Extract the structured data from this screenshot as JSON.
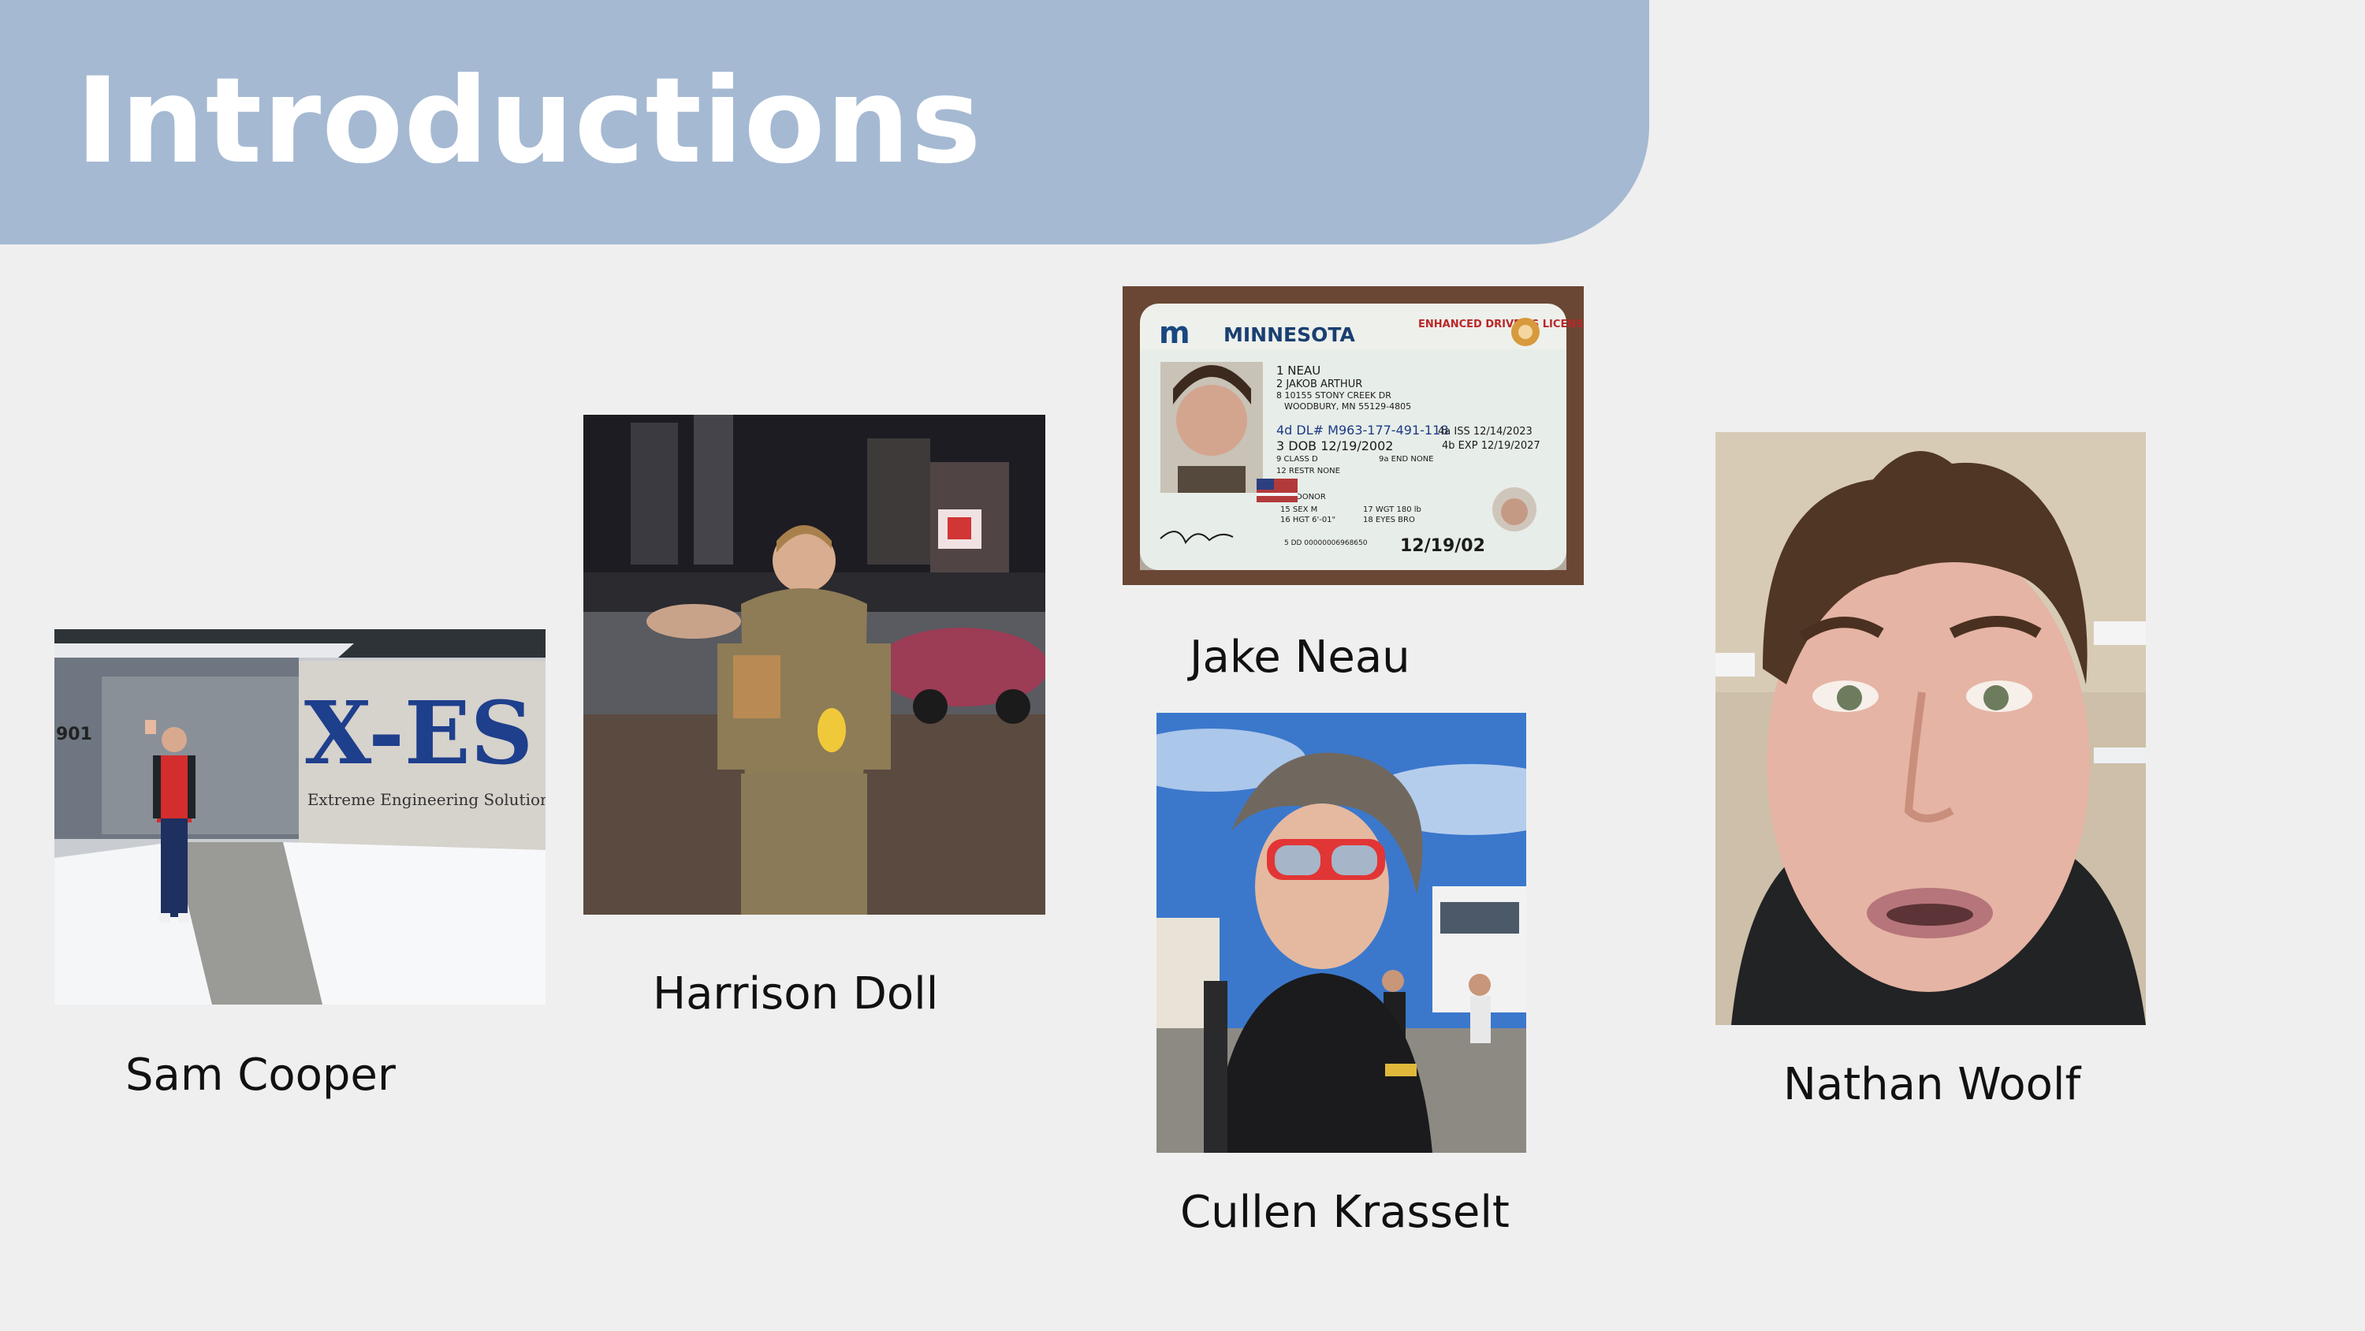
{
  "slide": {
    "title": "Introductions"
  },
  "people": [
    {
      "name": "Sam Cooper"
    },
    {
      "name": "Harrison Doll"
    },
    {
      "name": "Jake Neau"
    },
    {
      "name": "Cullen Krasselt"
    },
    {
      "name": "Nathan Woolf"
    }
  ],
  "photos": {
    "sam_building_number": "901",
    "sam_sign_logo": "X-ES",
    "sam_sign_caption": "Extreme Engineering Solutions",
    "id_card": {
      "state": "MINNESOTA",
      "license_type": "ENHANCED DRIVER'S LICENSE",
      "lines": [
        "1 NEAU",
        "2 JAKOB ARTHUR",
        "8 10155 STONY CREEK DR",
        "WOODBURY, MN 55129-4805"
      ],
      "dl_number": "4d DL# M963-177-491-118",
      "iss": "4a ISS 12/14/2023",
      "dob": "3 DOB 12/19/2002",
      "exp": "4b EXP 12/19/2027",
      "class": "9 CLASS D",
      "end": "9a END NONE",
      "restr": "12 RESTR NONE",
      "donor": "DONOR",
      "sex": "15 SEX M",
      "hgt": "16 HGT 6'-01\"",
      "wgt": "17 WGT 180 lb",
      "eyes": "18 EYES BRO",
      "dd": "5 DD 00000006968650",
      "big_dob": "12/19/02"
    }
  }
}
